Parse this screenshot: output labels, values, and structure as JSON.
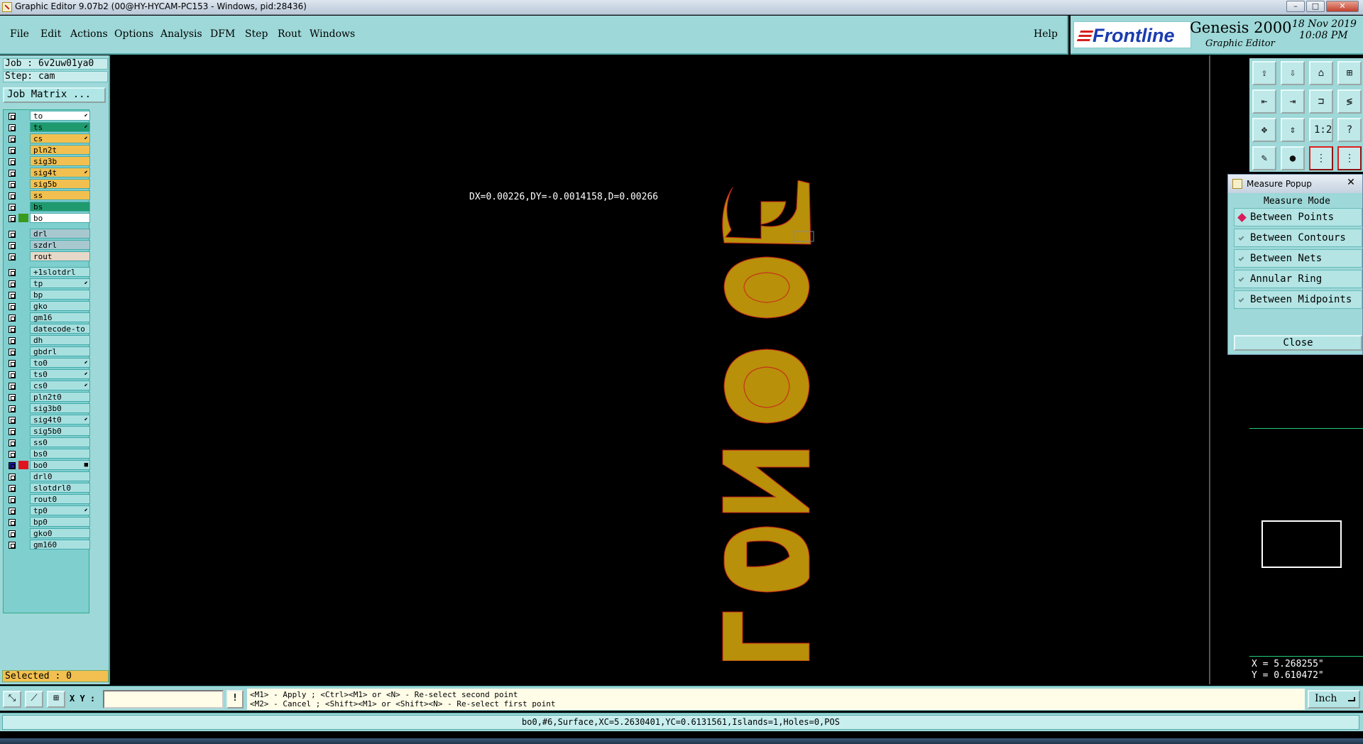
{
  "window": {
    "title": "Graphic Editor 9.07b2 (00@HY-HYCAM-PC153 - Windows, pid:28436)",
    "controls": [
      "–",
      "□",
      "✕"
    ]
  },
  "menu": {
    "items": [
      "File",
      "Edit",
      "Actions",
      "Options",
      "Analysis",
      "DFM",
      "Step",
      "Rout",
      "Windows"
    ],
    "help": "Help"
  },
  "brand": {
    "logo": "Frontline",
    "product": "Genesis 2000",
    "subtitle": "Graphic Editor",
    "date": "18 Nov 2019",
    "time": "10:08 PM"
  },
  "job": {
    "job_line": "Job : 6v2uw01ya0",
    "step_line": "Step: cam",
    "matrix_button": "Job Matrix ..."
  },
  "layers": [
    {
      "name": "to",
      "color": "#ffffff",
      "mark": "⬋",
      "swatch": ""
    },
    {
      "name": "ts",
      "color": "#1f9a6e",
      "mark": "⬋",
      "swatch": ""
    },
    {
      "name": "cs",
      "color": "#f2c050",
      "mark": "⬋",
      "swatch": ""
    },
    {
      "name": "pln2t",
      "color": "#f2c050",
      "mark": "",
      "swatch": ""
    },
    {
      "name": "sig3b",
      "color": "#f2c050",
      "mark": "",
      "swatch": ""
    },
    {
      "name": "sig4t",
      "color": "#f2c050",
      "mark": "⬋",
      "swatch": ""
    },
    {
      "name": "sig5b",
      "color": "#f2c050",
      "mark": "",
      "swatch": ""
    },
    {
      "name": "ss",
      "color": "#f2c050",
      "mark": "",
      "swatch": ""
    },
    {
      "name": "bs",
      "color": "#1f9a6e",
      "mark": "",
      "swatch": ""
    },
    {
      "name": "bo",
      "color": "#ffffff",
      "mark": "",
      "swatch": "#3a9a1e"
    },
    {
      "name": "drl",
      "color": "#a8c8d0",
      "mark": "",
      "swatch": ""
    },
    {
      "name": "szdrl",
      "color": "#a8c8d0",
      "mark": "",
      "swatch": ""
    },
    {
      "name": "rout",
      "color": "#e6d8c8",
      "mark": "",
      "swatch": ""
    },
    {
      "name": "+1slotdrl",
      "color": "#a8e0e0",
      "mark": "",
      "swatch": ""
    },
    {
      "name": "tp",
      "color": "#a8e0e0",
      "mark": "⬋",
      "swatch": ""
    },
    {
      "name": "bp",
      "color": "#a8e0e0",
      "mark": "",
      "swatch": ""
    },
    {
      "name": "gko",
      "color": "#a8e0e0",
      "mark": "",
      "swatch": ""
    },
    {
      "name": "gm16",
      "color": "#a8e0e0",
      "mark": "",
      "swatch": ""
    },
    {
      "name": "datecode-to",
      "color": "#a8e0e0",
      "mark": "",
      "swatch": ""
    },
    {
      "name": "dh",
      "color": "#a8e0e0",
      "mark": "",
      "swatch": ""
    },
    {
      "name": "gbdrl",
      "color": "#a8e0e0",
      "mark": "",
      "swatch": ""
    },
    {
      "name": "to0",
      "color": "#a8e0e0",
      "mark": "⬋",
      "swatch": ""
    },
    {
      "name": "ts0",
      "color": "#a8e0e0",
      "mark": "⬋",
      "swatch": ""
    },
    {
      "name": "cs0",
      "color": "#a8e0e0",
      "mark": "⬋",
      "swatch": ""
    },
    {
      "name": "pln2t0",
      "color": "#a8e0e0",
      "mark": "",
      "swatch": ""
    },
    {
      "name": "sig3b0",
      "color": "#a8e0e0",
      "mark": "",
      "swatch": ""
    },
    {
      "name": "sig4t0",
      "color": "#a8e0e0",
      "mark": "⬋",
      "swatch": ""
    },
    {
      "name": "sig5b0",
      "color": "#a8e0e0",
      "mark": "",
      "swatch": ""
    },
    {
      "name": "ss0",
      "color": "#a8e0e0",
      "mark": "",
      "swatch": ""
    },
    {
      "name": "bs0",
      "color": "#a8e0e0",
      "mark": "",
      "swatch": ""
    },
    {
      "name": "bo0",
      "color": "#a8e0e0",
      "mark": "■",
      "swatch": "#e0141e",
      "active": true
    },
    {
      "name": "drl0",
      "color": "#a8e0e0",
      "mark": "",
      "swatch": ""
    },
    {
      "name": "slotdrl0",
      "color": "#a8e0e0",
      "mark": "",
      "swatch": ""
    },
    {
      "name": "rout0",
      "color": "#a8e0e0",
      "mark": "",
      "swatch": ""
    },
    {
      "name": "tp0",
      "color": "#a8e0e0",
      "mark": "⬋",
      "swatch": ""
    },
    {
      "name": "bp0",
      "color": "#a8e0e0",
      "mark": "",
      "swatch": ""
    },
    {
      "name": "gko0",
      "color": "#a8e0e0",
      "mark": "",
      "swatch": ""
    },
    {
      "name": "gm160",
      "color": "#a8e0e0",
      "mark": "",
      "swatch": ""
    }
  ],
  "selected": "Selected : 0",
  "canvas": {
    "measure_readout": "DX=0.00226,DY=-0.0014158,D=0.00266"
  },
  "tools": [
    {
      "name": "open-layer-tool",
      "glyph": "⇪"
    },
    {
      "name": "save-tool",
      "glyph": "⇩"
    },
    {
      "name": "home-tool",
      "glyph": "⌂"
    },
    {
      "name": "split-view-tool",
      "glyph": "⊞"
    },
    {
      "name": "pan-left-tool",
      "glyph": "⇤"
    },
    {
      "name": "pan-right-tool",
      "glyph": "⇥"
    },
    {
      "name": "snap-tool",
      "glyph": "⊐"
    },
    {
      "name": "route-tool",
      "glyph": "≶"
    },
    {
      "name": "fit-tool",
      "glyph": "✥"
    },
    {
      "name": "zoom-fit-tool",
      "glyph": "⇕"
    },
    {
      "name": "scale-tool",
      "glyph": "1:2"
    },
    {
      "name": "help-tool",
      "glyph": "?"
    },
    {
      "name": "layer-tool",
      "glyph": "✎"
    },
    {
      "name": "probe-tool",
      "glyph": "●"
    },
    {
      "name": "net-tool",
      "glyph": "⋮"
    },
    {
      "name": "net-compare-tool",
      "glyph": "⋮"
    }
  ],
  "measure_popup": {
    "title": "Measure Popup",
    "mode_title": "Measure Mode",
    "options": [
      {
        "label": "Between Points",
        "selected": true
      },
      {
        "label": "Between Contours",
        "selected": false
      },
      {
        "label": "Between Nets",
        "selected": false
      },
      {
        "label": "Annular Ring",
        "selected": false
      },
      {
        "label": "Between Midpoints",
        "selected": false
      }
    ],
    "close_label": "Close"
  },
  "coords": {
    "x": "X = 5.268255\"",
    "y": "Y = 0.610472\""
  },
  "bottom": {
    "xy_label": "X Y :",
    "xy_value": "",
    "info_btn": "!",
    "prompt_line1": "<M1> - Apply  ; <Ctrl><M1> or <N> - Re-select second point",
    "prompt_line2": "<M2> - Cancel ; <Shift><M1> or <Shift><N> - Re-select first point",
    "unit": "Inch"
  },
  "status": "bo0,#6,Surface,XC=5.2630401,YC=0.6131561,Islands=1,Holes=0,POS"
}
